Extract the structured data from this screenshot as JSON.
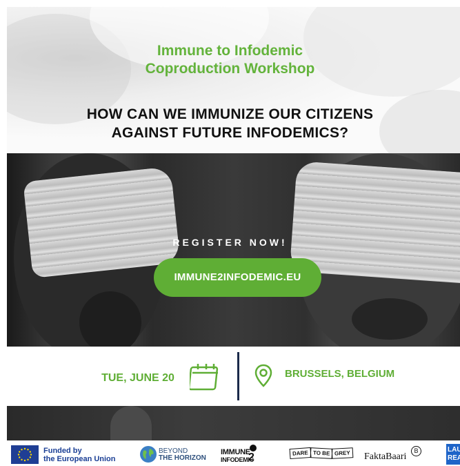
{
  "hero": {
    "subtitle_line1": "Immune to Infodemic",
    "subtitle_line2": "Coproduction Workshop",
    "headline_line1": "HOW CAN WE IMMUNIZE OUR CITIZENS",
    "headline_line2": "AGAINST FUTURE INFODEMICS?"
  },
  "cta": {
    "register_label": "REGISTER NOW!",
    "link_label": "IMMUNE2INFODEMIC.EU"
  },
  "event": {
    "date": "TUE, JUNE 20",
    "location": "BRUSSELS, BELGIUM"
  },
  "partners": {
    "eu_funded_line1": "Funded by",
    "eu_funded_line2": "the European Union",
    "beyond_line1": "BEYOND",
    "beyond_line2": "THE HORIZON",
    "immune_line1": "IMMUNE",
    "immune_line2": "INFODEMIC",
    "immune_number": "2",
    "dare_words": [
      "DARE",
      "TO BE",
      "GREY"
    ],
    "faktabaari": "FaktaBaari",
    "faktabaari_mark": "B",
    "partial_logo_line1": "LAU",
    "partial_logo_line2": "REA"
  },
  "colors": {
    "accent_green": "#5fae35",
    "headline_dark": "#111111",
    "eu_blue": "#1f3e94",
    "divider_navy": "#1b2a4a"
  }
}
